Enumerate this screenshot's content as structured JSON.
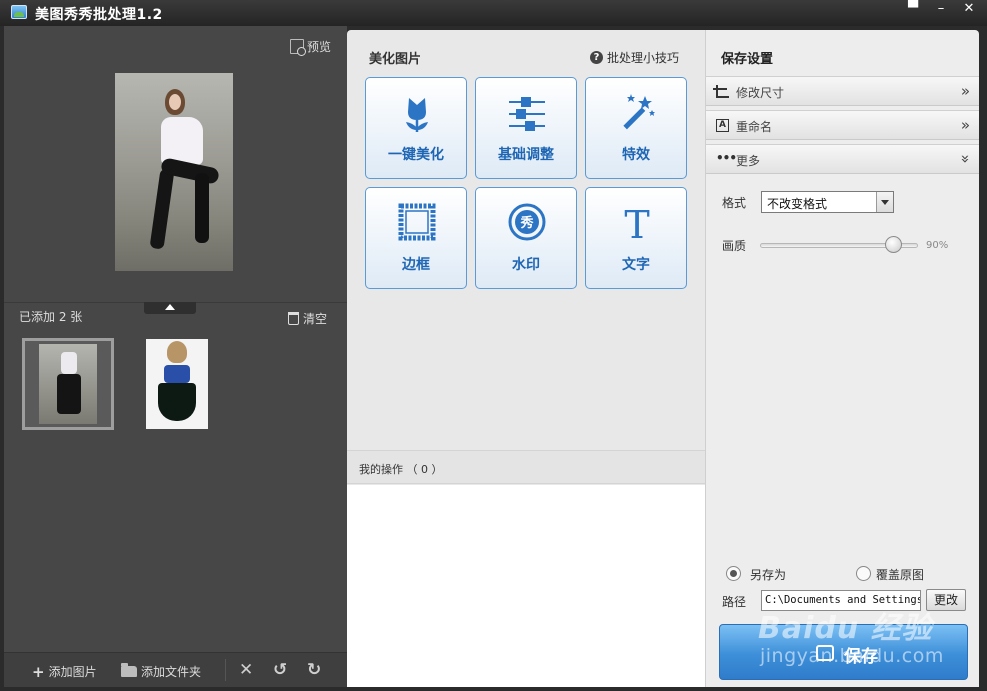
{
  "window": {
    "title": "美图秀秀批处理1.2",
    "controls": [
      "feedback-icon",
      "minimize-icon",
      "close-icon"
    ]
  },
  "left": {
    "preview_label": "预览",
    "added_count": "已添加 2 张",
    "clear_label": "清空",
    "bottom": {
      "add_image": "添加图片",
      "add_folder": "添加文件夹"
    }
  },
  "middle": {
    "title": "美化图片",
    "tips": "批处理小技巧",
    "tools": [
      {
        "label": "一键美化",
        "icon": "tulip-icon"
      },
      {
        "label": "基础调整",
        "icon": "sliders-icon"
      },
      {
        "label": "特效",
        "icon": "magic-wand-icon"
      },
      {
        "label": "边框",
        "icon": "frame-icon"
      },
      {
        "label": "水印",
        "icon": "watermark-seal-icon"
      },
      {
        "label": "文字",
        "icon": "text-T-icon"
      }
    ],
    "ops_label": "我的操作 （ 0 ）"
  },
  "right": {
    "title": "保存设置",
    "resize": "修改尺寸",
    "rename": "重命名",
    "more": "更多",
    "format_label": "格式",
    "format_value": "不改变格式",
    "quality_label": "画质",
    "quality_value": "90%",
    "quality_fraction": 0.9,
    "save_as": "另存为",
    "overwrite": "覆盖原图",
    "path_label": "路径",
    "path_value": "C:\\Documents and Settings\\",
    "change": "更改",
    "save": "保存"
  },
  "watermark": {
    "line1": "Baidu 经验",
    "line2": "jingyan.baidu.com"
  },
  "colors": {
    "accent": "#1e66b4",
    "save_button": "#3d8fd9",
    "dark_panel": "#474747"
  }
}
